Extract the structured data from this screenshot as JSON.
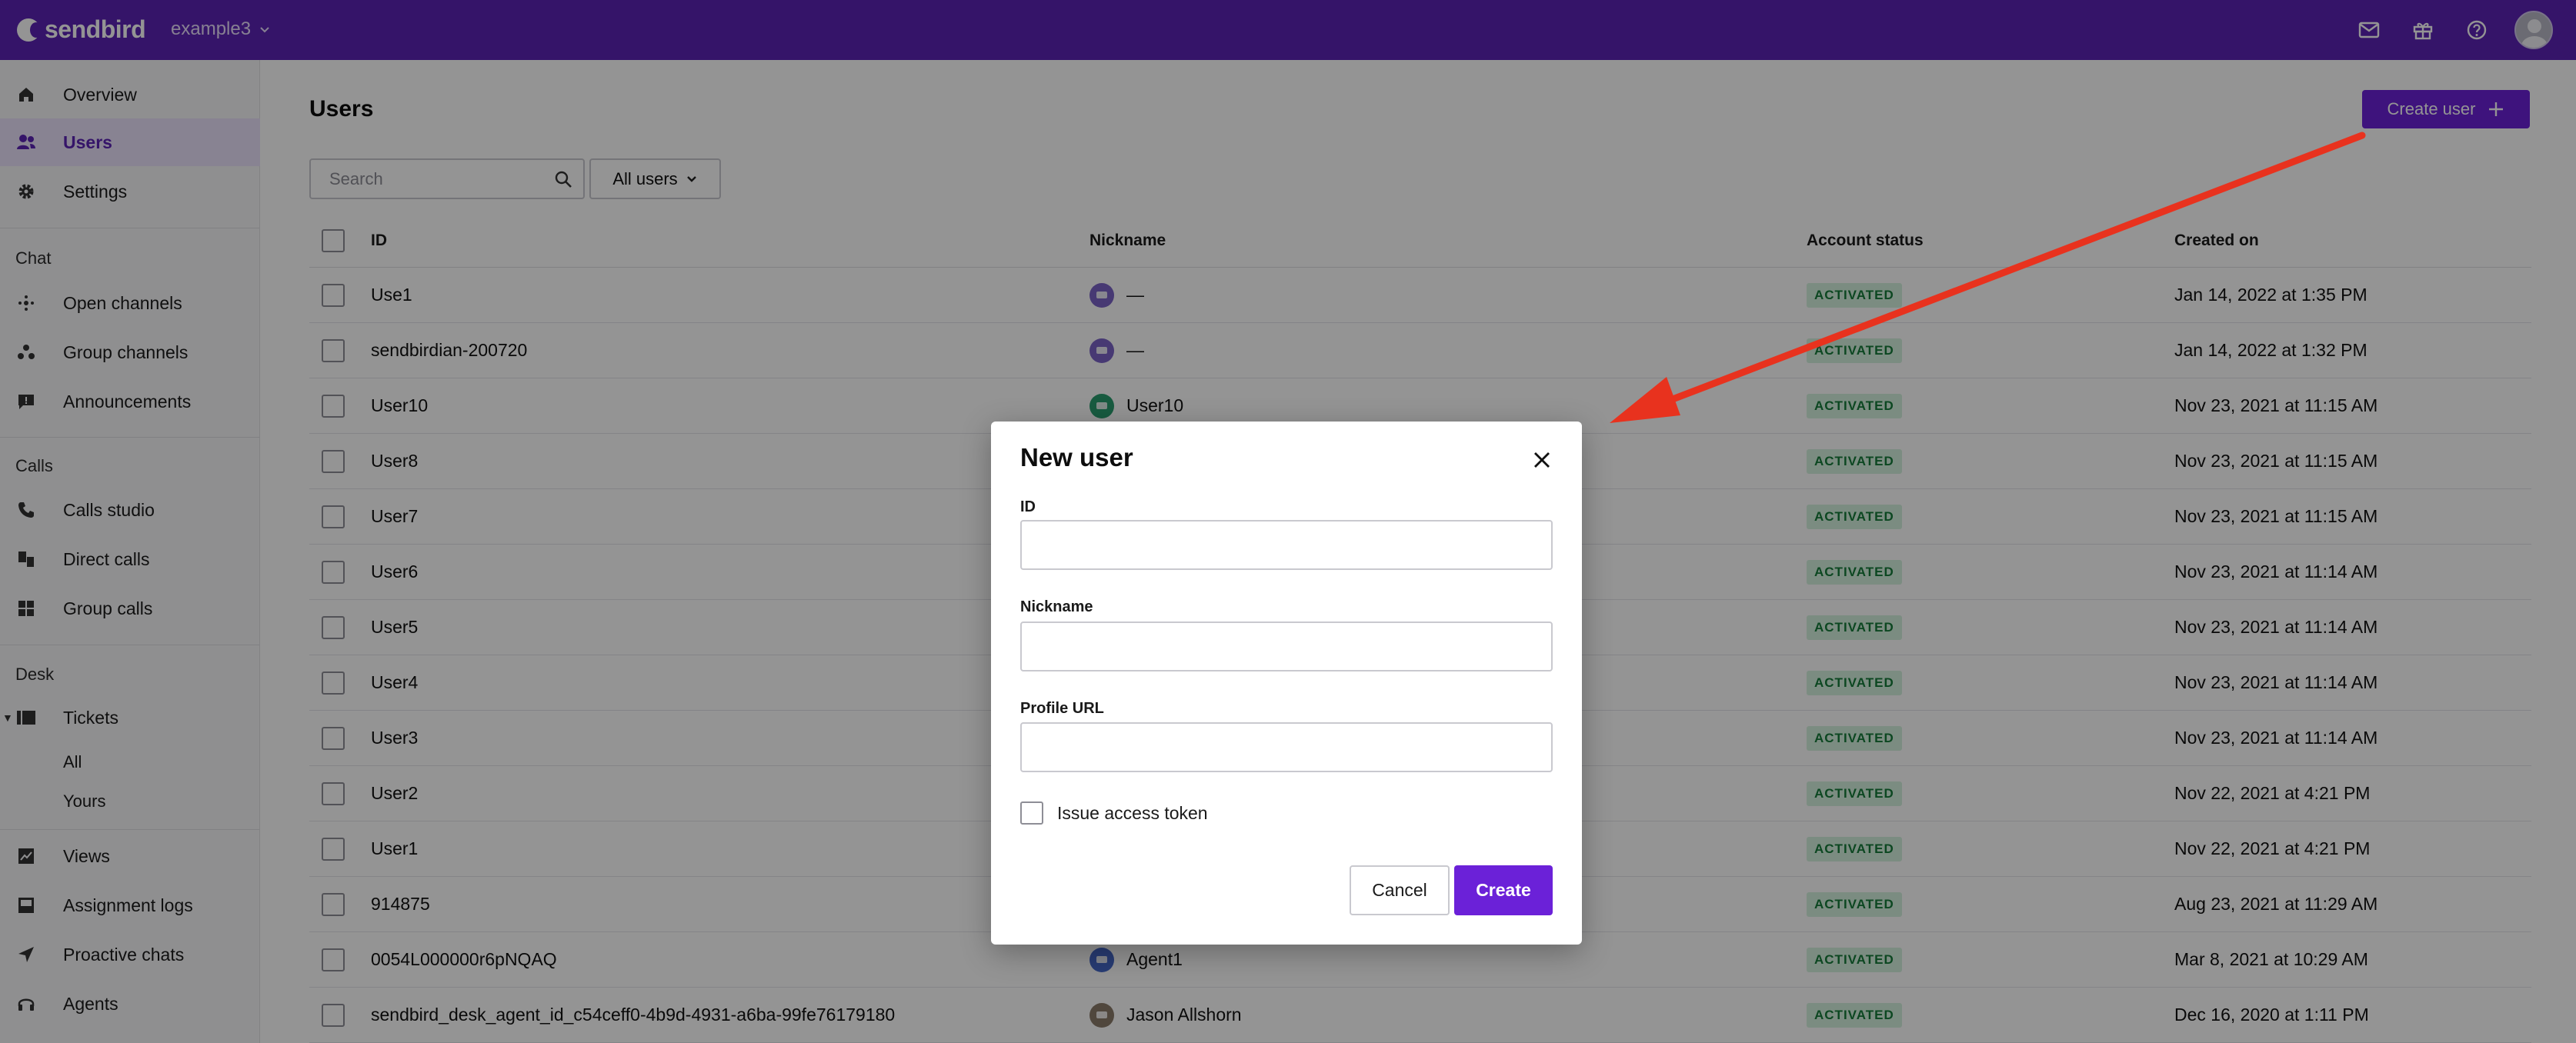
{
  "topbar": {
    "logo_text": "sendbird",
    "app_name": "example3",
    "icons": [
      "mail-icon",
      "gift-icon",
      "help-icon"
    ]
  },
  "sidebar": {
    "items_top": [
      {
        "label": "Overview",
        "icon": "home-icon"
      },
      {
        "label": "Users",
        "icon": "users-icon",
        "active": true
      },
      {
        "label": "Settings",
        "icon": "gear-icon"
      }
    ],
    "chat": {
      "section": "Chat",
      "items": [
        {
          "label": "Open channels",
          "icon": "open-channels-icon"
        },
        {
          "label": "Group channels",
          "icon": "group-channels-icon"
        },
        {
          "label": "Announcements",
          "icon": "announcement-icon"
        }
      ]
    },
    "calls": {
      "section": "Calls",
      "items": [
        {
          "label": "Calls studio",
          "icon": "phone-icon"
        },
        {
          "label": "Direct calls",
          "icon": "direct-calls-icon"
        },
        {
          "label": "Group calls",
          "icon": "group-calls-icon"
        }
      ]
    },
    "desk": {
      "section": "Desk",
      "tickets": "Tickets",
      "sub_all": "All",
      "sub_yours": "Yours",
      "items": [
        {
          "label": "Views",
          "icon": "views-icon"
        },
        {
          "label": "Assignment logs",
          "icon": "inbox-icon"
        },
        {
          "label": "Proactive chats",
          "icon": "send-icon"
        },
        {
          "label": "Agents",
          "icon": "headset-icon"
        }
      ]
    }
  },
  "main": {
    "title": "Users",
    "create_user_label": "Create user",
    "search_placeholder": "Search",
    "filter_label": "All users",
    "columns": {
      "id": "ID",
      "nickname": "Nickname",
      "status": "Account status",
      "created": "Created on"
    },
    "rows": [
      {
        "id": "Use1",
        "nickname": "—",
        "avatar": "purple",
        "status": "ACTIVATED",
        "created": "Jan 14, 2022 at 1:35 PM"
      },
      {
        "id": "sendbirdian-200720",
        "nickname": "—",
        "avatar": "purple",
        "status": "ACTIVATED",
        "created": "Jan 14, 2022 at 1:32 PM"
      },
      {
        "id": "User10",
        "nickname": "User10",
        "avatar": "green",
        "status": "ACTIVATED",
        "created": "Nov 23, 2021 at 11:15 AM"
      },
      {
        "id": "User8",
        "nickname": "",
        "avatar": "",
        "status": "ACTIVATED",
        "created": "Nov 23, 2021 at 11:15 AM"
      },
      {
        "id": "User7",
        "nickname": "",
        "avatar": "",
        "status": "ACTIVATED",
        "created": "Nov 23, 2021 at 11:15 AM"
      },
      {
        "id": "User6",
        "nickname": "",
        "avatar": "",
        "status": "ACTIVATED",
        "created": "Nov 23, 2021 at 11:14 AM"
      },
      {
        "id": "User5",
        "nickname": "",
        "avatar": "",
        "status": "ACTIVATED",
        "created": "Nov 23, 2021 at 11:14 AM"
      },
      {
        "id": "User4",
        "nickname": "",
        "avatar": "",
        "status": "ACTIVATED",
        "created": "Nov 23, 2021 at 11:14 AM"
      },
      {
        "id": "User3",
        "nickname": "",
        "avatar": "",
        "status": "ACTIVATED",
        "created": "Nov 23, 2021 at 11:14 AM"
      },
      {
        "id": "User2",
        "nickname": "",
        "avatar": "",
        "status": "ACTIVATED",
        "created": "Nov 22, 2021 at 4:21 PM"
      },
      {
        "id": "User1",
        "nickname": "",
        "avatar": "",
        "status": "ACTIVATED",
        "created": "Nov 22, 2021 at 4:21 PM"
      },
      {
        "id": "914875",
        "nickname": "",
        "avatar": "",
        "status": "ACTIVATED",
        "created": "Aug 23, 2021 at 11:29 AM"
      },
      {
        "id": "0054L000000r6pNQAQ",
        "nickname": "Agent1",
        "avatar": "blue",
        "status": "ACTIVATED",
        "created": "Mar 8, 2021 at 10:29 AM"
      },
      {
        "id": "sendbird_desk_agent_id_c54ceff0-4b9d-4931-a6ba-99fe76179180",
        "nickname": "Jason Allshorn",
        "avatar": "photo",
        "status": "ACTIVATED",
        "created": "Dec 16, 2020 at 1:11 PM"
      }
    ]
  },
  "modal": {
    "title": "New user",
    "id_label": "ID",
    "id_value": "",
    "nickname_label": "Nickname",
    "nickname_value": "",
    "profile_url_label": "Profile URL",
    "profile_url_value": "",
    "issue_token_label": "Issue access token",
    "issue_token_checked": false,
    "cancel_label": "Cancel",
    "create_label": "Create"
  },
  "colors": {
    "brand": "#5c24b5",
    "primary_button": "#6b21d8",
    "badge_bg": "#d5f2de",
    "badge_text": "#157a3a",
    "annotation_arrow": "#e8321e"
  }
}
